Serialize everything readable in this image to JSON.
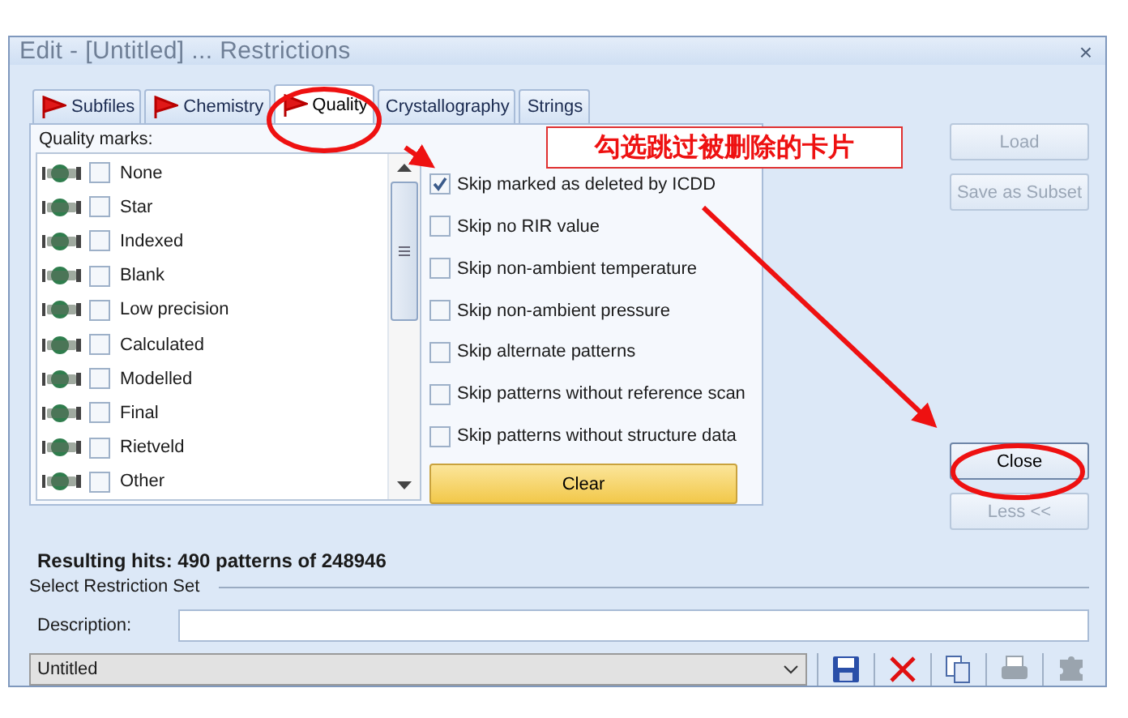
{
  "window": {
    "title": "Edit - [Untitled] ... Restrictions",
    "close": "×"
  },
  "tabs": [
    {
      "label": "Subfiles",
      "selected": false,
      "flag": true
    },
    {
      "label": "Chemistry",
      "selected": false,
      "flag": true
    },
    {
      "label": "Quality",
      "selected": true,
      "flag": true
    },
    {
      "label": "Crystallography",
      "selected": false,
      "flag": false
    },
    {
      "label": "Strings",
      "selected": false,
      "flag": false
    }
  ],
  "quality_marks": {
    "label": "Quality marks:",
    "items": [
      {
        "label": "None",
        "checked": false
      },
      {
        "label": "Star",
        "checked": false
      },
      {
        "label": "Indexed",
        "checked": false
      },
      {
        "label": "Blank",
        "checked": false
      },
      {
        "label": "Low precision",
        "checked": false
      },
      {
        "label": "Calculated",
        "checked": false
      },
      {
        "label": "Modelled",
        "checked": false
      },
      {
        "label": "Final",
        "checked": false
      },
      {
        "label": "Rietveld",
        "checked": false
      },
      {
        "label": "Other",
        "checked": false
      }
    ]
  },
  "options": [
    {
      "label": "Skip marked as deleted by ICDD",
      "checked": true
    },
    {
      "label": "Skip no RIR value",
      "checked": false
    },
    {
      "label": "Skip non-ambient temperature",
      "checked": false
    },
    {
      "label": "Skip non-ambient pressure",
      "checked": false
    },
    {
      "label": "Skip alternate patterns",
      "checked": false
    },
    {
      "label": "Skip patterns without reference scan",
      "checked": false
    },
    {
      "label": "Skip patterns without structure data",
      "checked": false
    }
  ],
  "clear_button": "Clear",
  "top_buttons": [
    {
      "label": "Load",
      "disabled": true
    },
    {
      "label": "Save as Subset",
      "disabled": true
    }
  ],
  "bottom_buttons": [
    {
      "label": "Close",
      "disabled": false
    },
    {
      "label": "Less <<",
      "disabled": true
    }
  ],
  "result": "Resulting hits: 490 patterns of 248946",
  "restriction_set": {
    "heading": "Select Restriction Set",
    "description_label": "Description:",
    "set_value": "Untitled"
  },
  "toolbar": [
    {
      "kind": "save",
      "disabled": false
    },
    {
      "kind": "delete",
      "disabled": false
    },
    {
      "kind": "copy",
      "disabled": false
    },
    {
      "kind": "print",
      "disabled": true
    },
    {
      "kind": "puzzle",
      "disabled": true
    }
  ],
  "annotation": {
    "callout": "勾选跳过被删除的卡片"
  }
}
